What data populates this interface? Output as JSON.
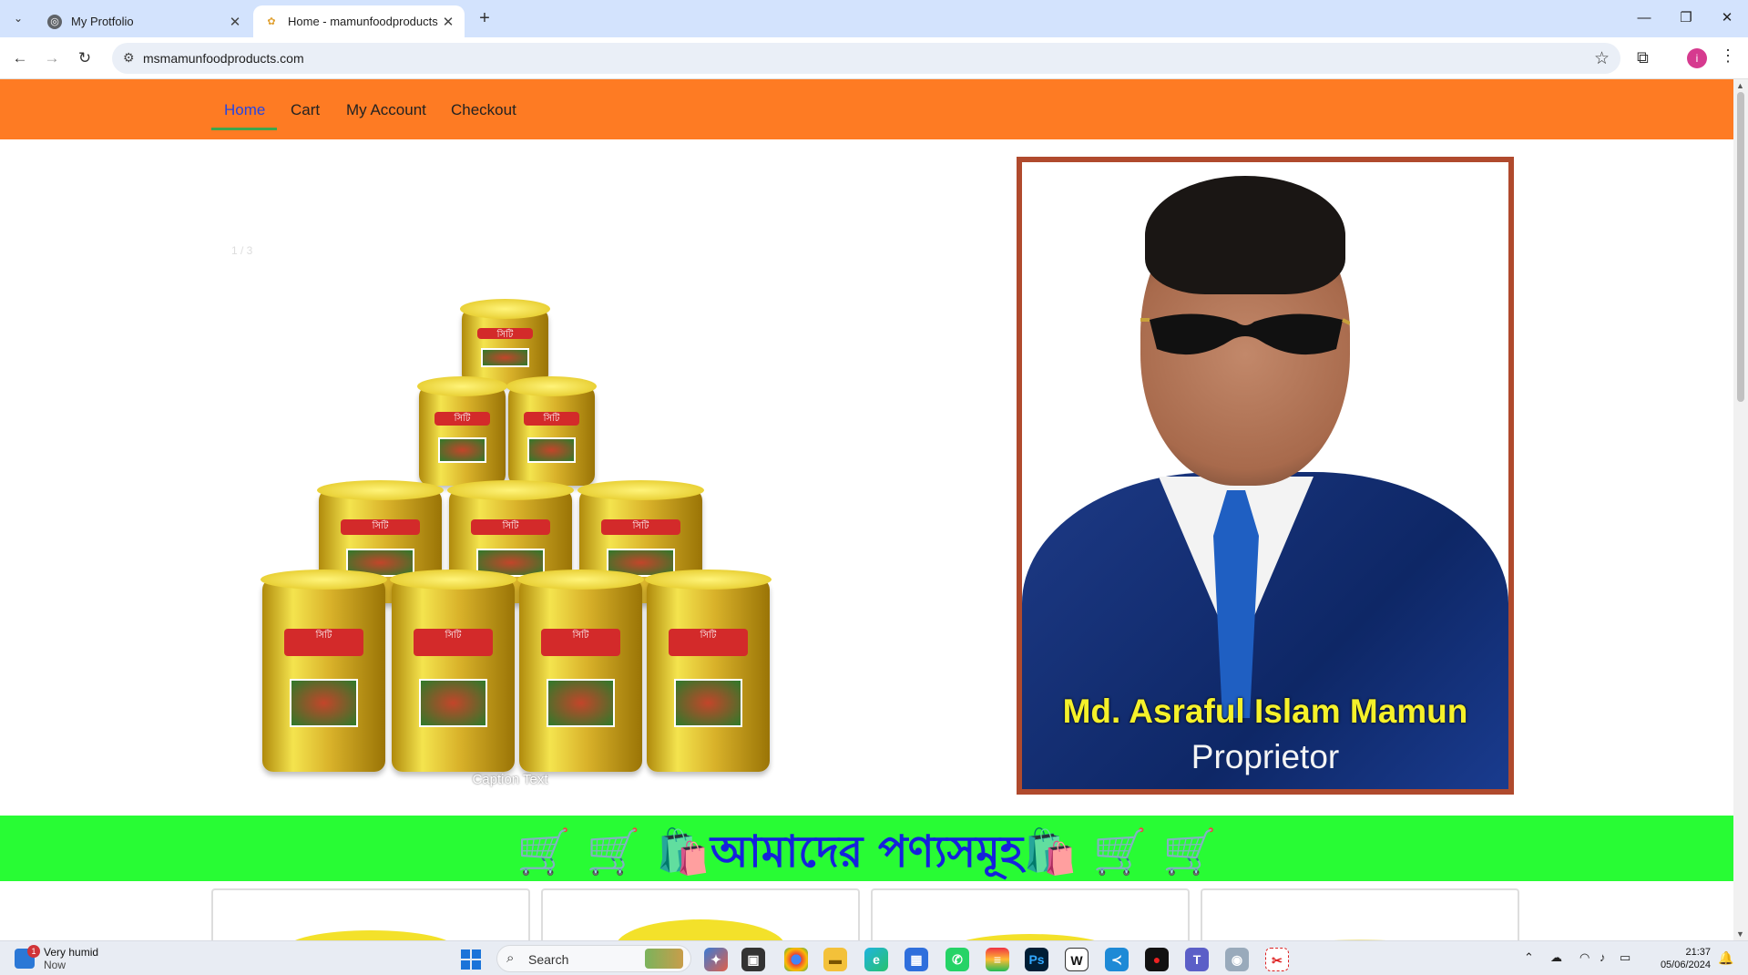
{
  "browser": {
    "tabs": [
      {
        "title": "My Protfolio",
        "active": false
      },
      {
        "title": "Home - mamunfoodproducts",
        "active": true
      }
    ],
    "url": "msmamunfoodproducts.com"
  },
  "site": {
    "nav": [
      {
        "label": "Home",
        "active": true
      },
      {
        "label": "Cart",
        "active": false
      },
      {
        "label": "My Account",
        "active": false
      },
      {
        "label": "Checkout",
        "active": false
      }
    ],
    "slider": {
      "counter": "1 / 3",
      "caption": "Caption Text",
      "dots": 3,
      "active_dot": 1,
      "product_label": "সিটি"
    },
    "owner": {
      "name": "Md. Asraful Islam Mamun",
      "role": "Proprietor"
    },
    "banner": {
      "text": "🛒 🛒 🛍️আমাদের পণ্যসমূহ🛍️ 🛒 🛒"
    },
    "accent_colors": {
      "nav_bg": "#fe7b23",
      "banner_bg": "#28fc34",
      "banner_text": "#1521dd",
      "frame": "#b04a2d"
    }
  },
  "taskbar": {
    "weather": {
      "title": "Very humid",
      "sub": "Now",
      "badge": "1"
    },
    "search_placeholder": "Search",
    "time": "21:37",
    "date": "05/06/2024"
  }
}
